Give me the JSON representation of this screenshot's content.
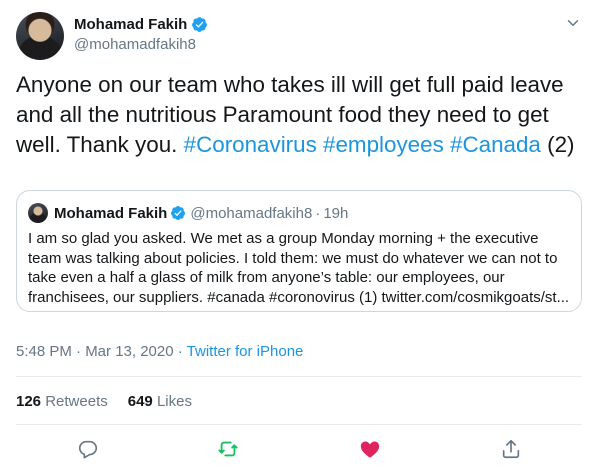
{
  "author": {
    "name": "Mohamad Fakih",
    "handle": "@mohamadfakih8"
  },
  "tweet": {
    "text_plain": "Anyone on our team who takes ill will get full paid leave and all the nutritious Paramount food they need to get well. Thank you.",
    "hashtags": [
      "#Coronavirus",
      "#employees",
      "#Canada"
    ],
    "suffix": "(2)"
  },
  "quoted_tweet": {
    "name": "Mohamad Fakih",
    "handle": "@mohamadfakih8",
    "separator": "·",
    "time": "19h",
    "text": "I am so glad you asked. We met as a group Monday morning + the executive team was talking about policies. I told them: we must do whatever we can not to take even a half a glass of milk from anyone’s table: our employees, our franchisees, our suppliers. #canada #coronovirus (1) twitter.com/cosmikgoats/st..."
  },
  "meta": {
    "time": "5:48 PM · Mar 13, 2020 ·",
    "source": "Twitter for iPhone"
  },
  "stats": {
    "retweets_count": "126",
    "retweets_label": "Retweets",
    "likes_count": "649",
    "likes_label": "Likes"
  },
  "colors": {
    "link": "#1b95e0",
    "secondary_text": "#657786",
    "retweet": "#17bf63",
    "like": "#e0245e",
    "verified": "#1da1f2"
  },
  "icons": {
    "verified": "verified-badge-icon",
    "caret": "chevron-down-icon",
    "reply": "reply-icon",
    "retweet": "retweet-icon",
    "like": "heart-icon",
    "share": "share-icon"
  }
}
